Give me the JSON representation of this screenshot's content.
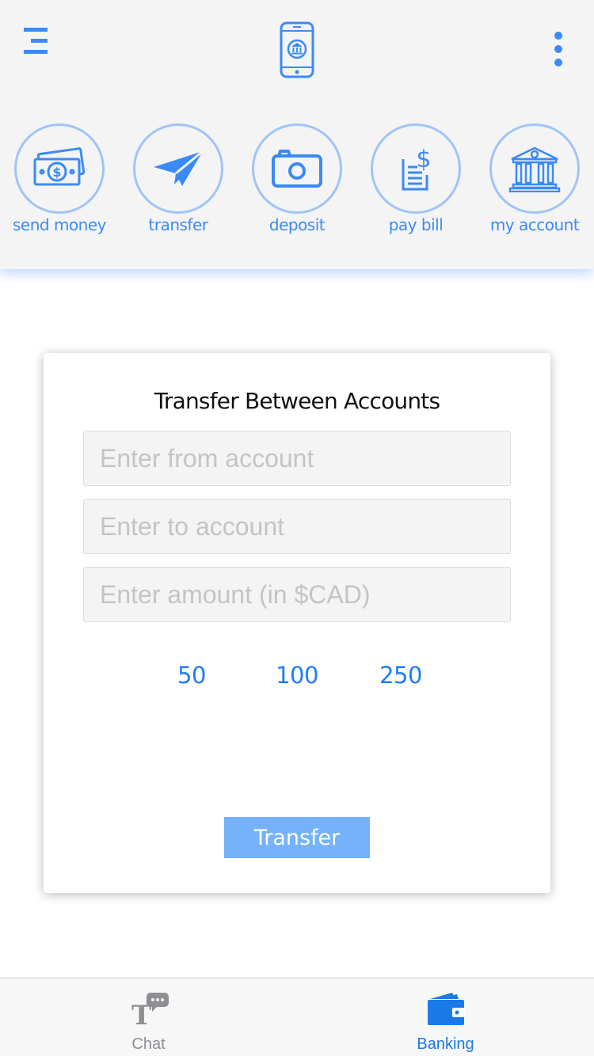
{
  "header": {
    "menu_icon": "menu-icon",
    "logo_icon": "phone-bank-logo-icon",
    "more_icon": "more-vertical-icon"
  },
  "actions": [
    {
      "label": "send money",
      "icon": "cash-icon"
    },
    {
      "label": "transfer",
      "icon": "paper-plane-icon"
    },
    {
      "label": "deposit",
      "icon": "camera-icon"
    },
    {
      "label": "pay bill",
      "icon": "bill-icon"
    },
    {
      "label": "my account",
      "icon": "bank-icon"
    }
  ],
  "card": {
    "title": "Transfer Between Accounts",
    "from_placeholder": "Enter from account",
    "to_placeholder": "Enter to account",
    "amount_placeholder": "Enter amount (in $CAD)",
    "quick_amounts": [
      "50",
      "100",
      "250"
    ],
    "submit_label": "Transfer"
  },
  "tabs": [
    {
      "label": "Chat",
      "icon": "chat-icon",
      "active": false
    },
    {
      "label": "Banking",
      "icon": "wallet-icon",
      "active": true
    }
  ],
  "colors": {
    "accent": "#3a8af7",
    "icon_ring": "#9fc4f8",
    "button": "#76b2fa",
    "active_tab": "#1a7ae8",
    "inactive_tab": "#8e8e93"
  }
}
